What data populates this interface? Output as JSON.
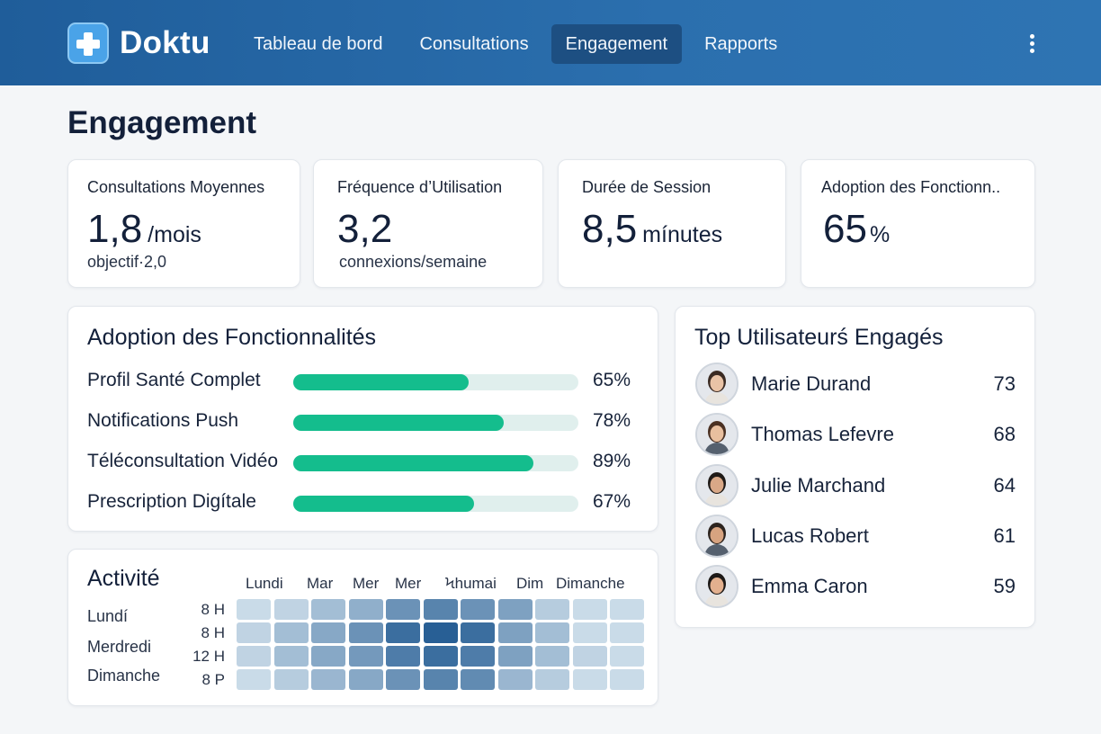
{
  "app": {
    "name": "Doktu",
    "logo_icon": "medical-cross-icon"
  },
  "nav": {
    "items": [
      {
        "label": "Tableau de bord",
        "active": false
      },
      {
        "label": "Consultations",
        "active": false
      },
      {
        "label": "Engagement",
        "active": true
      },
      {
        "label": "Rapports",
        "active": false
      }
    ],
    "menu_icon": "more-vertical-icon"
  },
  "page": {
    "title": "Engagement"
  },
  "kpis": [
    {
      "label": "Consultations Moyennes",
      "value": "1,8",
      "unit": "/mois",
      "sub": "objectif·2,0"
    },
    {
      "label": "Fréquence d’Utilisation",
      "value": "3,2",
      "unit": "",
      "sub": "connexions/semaine"
    },
    {
      "label": "Durée de Session",
      "value": "8,5",
      "unit": "mínutes",
      "sub": ""
    },
    {
      "label": "Adoption des Fonctionn..",
      "value": "65",
      "unit": "%",
      "sub": ""
    }
  ],
  "features": {
    "title": "Adoption des Fonctionnalités",
    "items": [
      {
        "label": "Profil Santé Complet",
        "percent": 65,
        "display": "65%"
      },
      {
        "label": "Notifications Push",
        "percent": 78,
        "display": "78%"
      },
      {
        "label": "Téléconsultation Vidéo",
        "percent": 89,
        "display": "89%"
      },
      {
        "label": "Prescription Digítale",
        "percent": 67,
        "display": "67%"
      }
    ],
    "fill_color": "#14bd8d",
    "track_color": "#e0efed"
  },
  "top_users": {
    "title": "Top Utilisateurś Engagés",
    "users": [
      {
        "name": "Marie Durand",
        "score": "73",
        "avatar_icon": "user-avatar-icon"
      },
      {
        "name": "Thomas Lefevre",
        "score": "68",
        "avatar_icon": "user-avatar-icon"
      },
      {
        "name": "Julie Marchand",
        "score": "64",
        "avatar_icon": "user-avatar-icon"
      },
      {
        "name": "Lucas Robert",
        "score": "61",
        "avatar_icon": "user-avatar-icon"
      },
      {
        "name": "Emma Caron",
        "score": "59",
        "avatar_icon": "user-avatar-icon"
      }
    ]
  },
  "activity": {
    "title": "Activité",
    "row_labels": [
      "Lundí",
      "Merdredi",
      "Dimanche"
    ],
    "columns": [
      "Lundi",
      "Mar",
      "Mer",
      "Mer",
      "Ϟhumai",
      "Dim",
      "Dimanche"
    ],
    "time_labels": [
      "8 H",
      "8 H",
      "12 H",
      "8 P"
    ],
    "intensity": [
      [
        0.1,
        0.15,
        0.3,
        0.4,
        0.6,
        0.7,
        0.6,
        0.5,
        0.2,
        0.1,
        0.1
      ],
      [
        0.15,
        0.3,
        0.45,
        0.6,
        0.85,
        0.95,
        0.85,
        0.5,
        0.3,
        0.1,
        0.1
      ],
      [
        0.15,
        0.3,
        0.45,
        0.55,
        0.75,
        0.85,
        0.75,
        0.5,
        0.3,
        0.15,
        0.1
      ],
      [
        0.1,
        0.2,
        0.35,
        0.45,
        0.6,
        0.7,
        0.65,
        0.35,
        0.2,
        0.1,
        0.1
      ]
    ],
    "color_low": "#dce9f2",
    "color_high": "#1f5890"
  }
}
